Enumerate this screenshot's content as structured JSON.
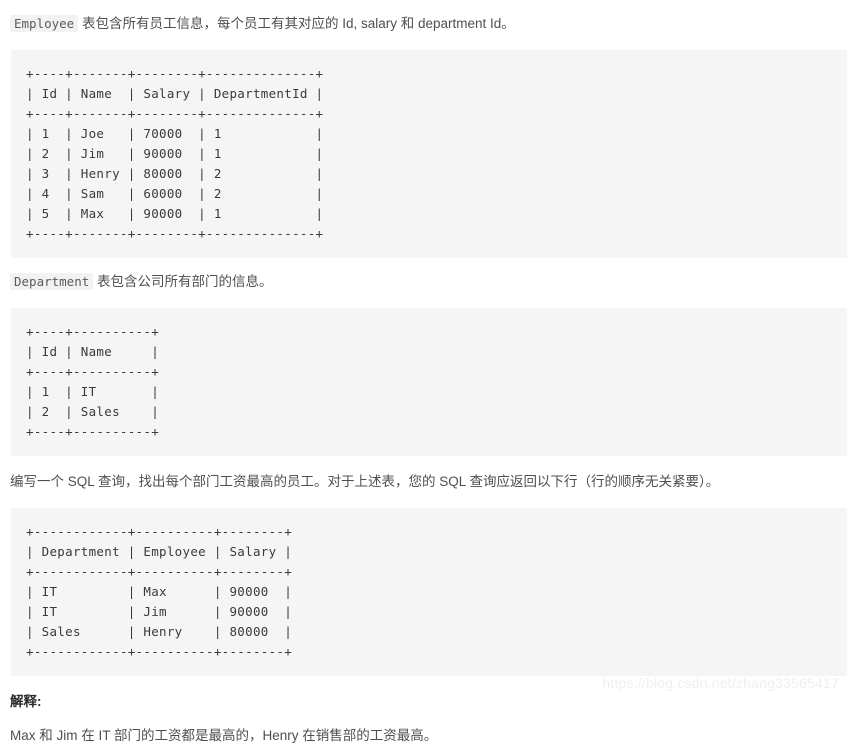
{
  "paragraphs": {
    "intro_code": "Employee",
    "intro_text": " 表包含所有员工信息，每个员工有其对应的 Id, salary 和 department Id。",
    "dept_code": "Department",
    "dept_text": " 表包含公司所有部门的信息。",
    "query_text": "编写一个 SQL 查询，找出每个部门工资最高的员工。对于上述表，您的 SQL 查询应返回以下行（行的顺序无关紧要）。",
    "explain_heading": "解释:",
    "explain_text": "Max 和 Jim 在 IT 部门的工资都是最高的，Henry 在销售部的工资最高。"
  },
  "employee_table": {
    "rule": "+----+-------+--------+--------------+",
    "header": "| Id | Name  | Salary | DepartmentId |",
    "rows": [
      "| 1  | Joe   | 70000  | 1            |",
      "| 2  | Jim   | 90000  | 1            |",
      "| 3  | Henry | 80000  | 2            |",
      "| 4  | Sam   | 60000  | 2            |",
      "| 5  | Max   | 90000  | 1            |"
    ],
    "columns": [
      "Id",
      "Name",
      "Salary",
      "DepartmentId"
    ],
    "data": [
      {
        "Id": "1",
        "Name": "Joe",
        "Salary": "70000",
        "DepartmentId": "1"
      },
      {
        "Id": "2",
        "Name": "Jim",
        "Salary": "90000",
        "DepartmentId": "1"
      },
      {
        "Id": "3",
        "Name": "Henry",
        "Salary": "80000",
        "DepartmentId": "2"
      },
      {
        "Id": "4",
        "Name": "Sam",
        "Salary": "60000",
        "DepartmentId": "2"
      },
      {
        "Id": "5",
        "Name": "Max",
        "Salary": "90000",
        "DepartmentId": "1"
      }
    ]
  },
  "department_table": {
    "rule": "+----+----------+",
    "header": "| Id | Name     |",
    "rows": [
      "| 1  | IT       |",
      "| 2  | Sales    |"
    ],
    "columns": [
      "Id",
      "Name"
    ],
    "data": [
      {
        "Id": "1",
        "Name": "IT"
      },
      {
        "Id": "2",
        "Name": "Sales"
      }
    ]
  },
  "result_table": {
    "rule": "+------------+----------+--------+",
    "header": "| Department | Employee | Salary |",
    "rows": [
      "| IT         | Max      | 90000  |",
      "| IT         | Jim      | 90000  |",
      "| Sales      | Henry    | 80000  |"
    ],
    "columns": [
      "Department",
      "Employee",
      "Salary"
    ],
    "data": [
      {
        "Department": "IT",
        "Employee": "Max",
        "Salary": "90000"
      },
      {
        "Department": "IT",
        "Employee": "Jim",
        "Salary": "90000"
      },
      {
        "Department": "Sales",
        "Employee": "Henry",
        "Salary": "80000"
      }
    ]
  },
  "watermark": "https://blog.csdn.net/zhang33565417"
}
